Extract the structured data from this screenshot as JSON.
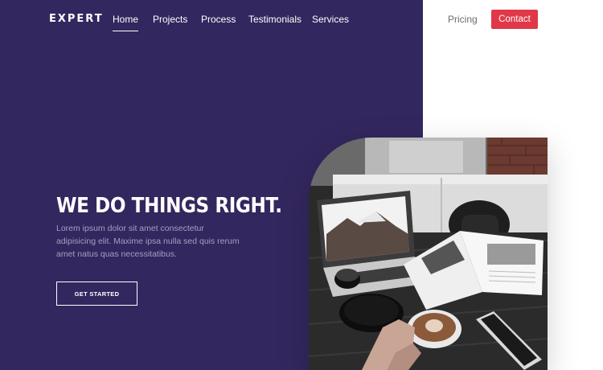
{
  "brand": {
    "logo": "EXPERT"
  },
  "nav": {
    "items": [
      {
        "label": "Home",
        "active": true
      },
      {
        "label": "Projects",
        "active": false
      },
      {
        "label": "Process",
        "active": false
      },
      {
        "label": "Testimonials",
        "active": false
      },
      {
        "label": "Services",
        "active": false
      }
    ],
    "pricing_label": "Pricing",
    "contact_label": "Contact"
  },
  "hero": {
    "title": "WE DO THINGS RIGHT.",
    "body_lines": [
      "Lorem ipsum dolor sit amet consectetur",
      "adipisicing elit. Maxime ipsa nulla sed quis rerum",
      "amet natus quas necessitatibus."
    ],
    "cta_label": "GET STARTED",
    "image_subject": "laptop, open magazine, coffee cup and phone on a wooden table"
  },
  "colors": {
    "panel": "#33275f",
    "accent": "#e03848",
    "nav_dark": "#6d6d73",
    "body_text": "#a49fc1"
  },
  "icons": []
}
